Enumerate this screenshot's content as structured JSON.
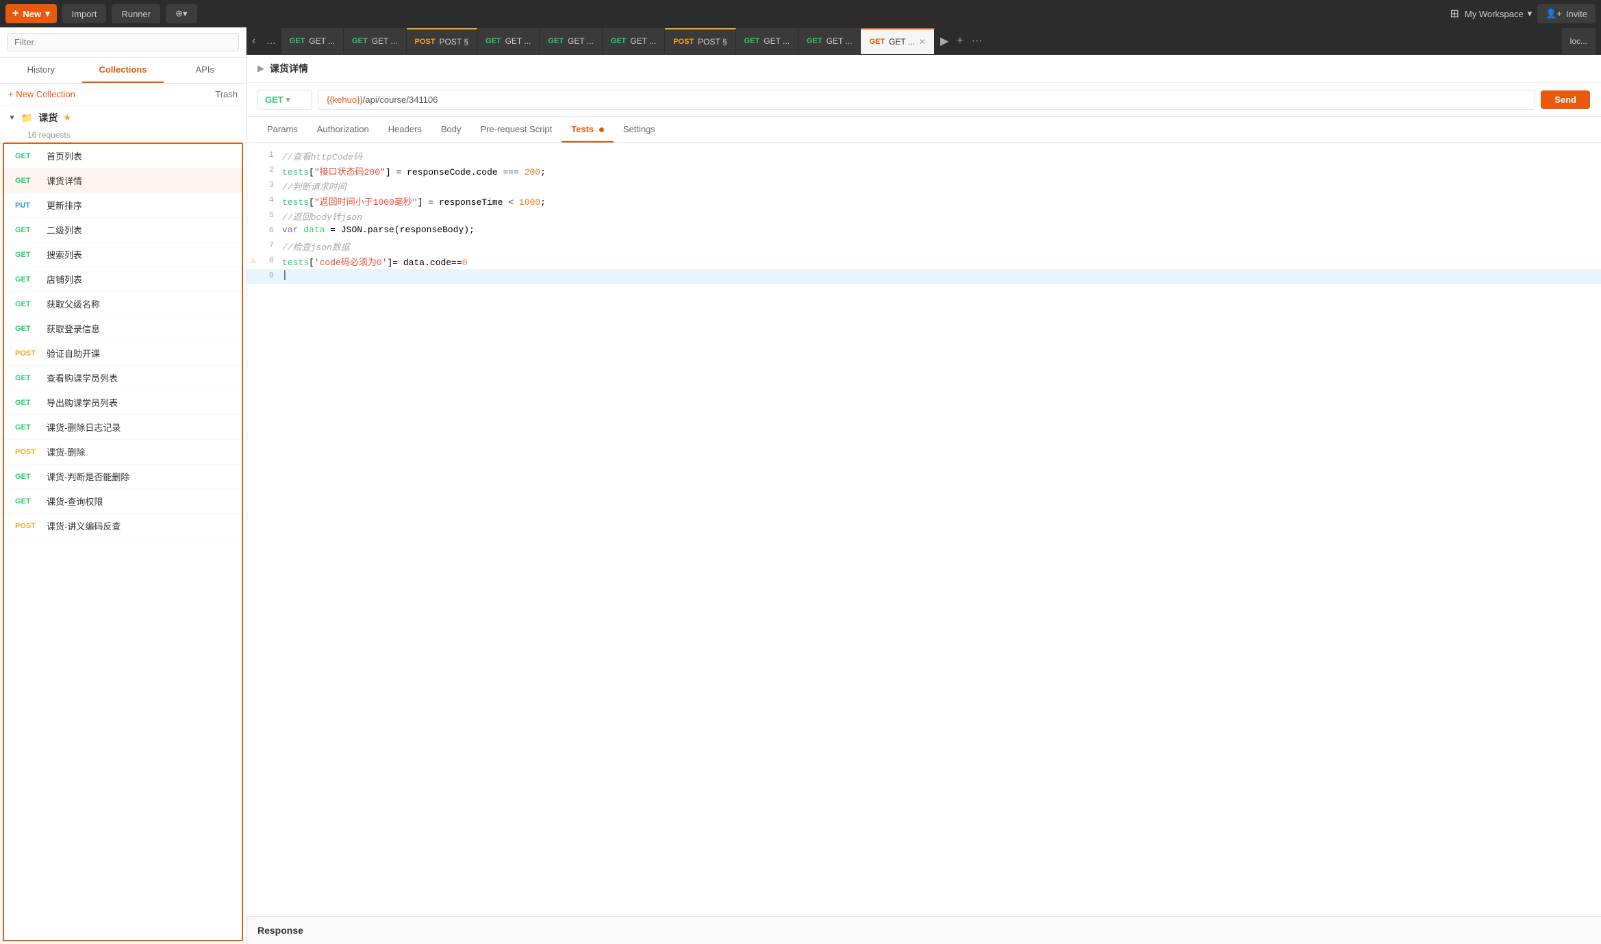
{
  "topbar": {
    "new_label": "New",
    "import_label": "Import",
    "runner_label": "Runner",
    "workspace_label": "My Workspace",
    "invite_label": "Invite"
  },
  "sidebar": {
    "filter_placeholder": "Filter",
    "tabs": [
      "History",
      "Collections",
      "APIs"
    ],
    "active_tab": "Collections",
    "new_collection_label": "+ New Collection",
    "trash_label": "Trash",
    "collection_name": "课货",
    "collection_count": "16 requests",
    "requests": [
      {
        "method": "GET",
        "name": "首页列表",
        "active": false
      },
      {
        "method": "GET",
        "name": "课货详情",
        "active": true
      },
      {
        "method": "PUT",
        "name": "更新排序",
        "active": false
      },
      {
        "method": "GET",
        "name": "二级列表",
        "active": false
      },
      {
        "method": "GET",
        "name": "搜索列表",
        "active": false
      },
      {
        "method": "GET",
        "name": "店铺列表",
        "active": false
      },
      {
        "method": "GET",
        "name": "获取父级名称",
        "active": false
      },
      {
        "method": "GET",
        "name": "获取登录信息",
        "active": false
      },
      {
        "method": "POST",
        "name": "验证自助开课",
        "active": false
      },
      {
        "method": "GET",
        "name": "查看购课学员列表",
        "active": false
      },
      {
        "method": "GET",
        "name": "导出购课学员列表",
        "active": false
      },
      {
        "method": "GET",
        "name": "课货-删除日志记录",
        "active": false
      },
      {
        "method": "POST",
        "name": "课货-删除",
        "active": false
      },
      {
        "method": "GET",
        "name": "课货-判断是否能删除",
        "active": false
      },
      {
        "method": "GET",
        "name": "课货-查询权限",
        "active": false
      },
      {
        "method": "POST",
        "name": "课货-讲义编码反查",
        "active": false
      }
    ]
  },
  "tabs_bar": {
    "tabs": [
      {
        "method": "GET",
        "label": "GET ...",
        "active": false,
        "closable": false
      },
      {
        "method": "GET",
        "label": "GET ...",
        "active": false,
        "closable": false
      },
      {
        "method": "POST",
        "label": "POST §",
        "active": false,
        "closable": false
      },
      {
        "method": "GET",
        "label": "GET ...",
        "active": false,
        "closable": false
      },
      {
        "method": "GET",
        "label": "GET ...",
        "active": false,
        "closable": false
      },
      {
        "method": "GET",
        "label": "GET ...",
        "active": false,
        "closable": false
      },
      {
        "method": "POST",
        "label": "POST §",
        "active": false,
        "closable": false
      },
      {
        "method": "GET",
        "label": "GET ...",
        "active": false,
        "closable": false
      },
      {
        "method": "GET",
        "label": "GET ...",
        "active": false,
        "closable": false
      },
      {
        "method": "GET",
        "label": "GET ...",
        "active": true,
        "closable": true
      }
    ]
  },
  "request": {
    "breadcrumb": "课货详情",
    "method": "GET",
    "url_prefix": "{{kehuo}}",
    "url_suffix": "/api/course/341106",
    "tabs": [
      "Params",
      "Authorization",
      "Headers",
      "Body",
      "Pre-request Script",
      "Tests",
      "Settings"
    ],
    "active_tab": "Tests",
    "tests_dot": true
  },
  "code_editor": {
    "lines": [
      {
        "num": 1,
        "content": "//查看httpCode码",
        "type": "comment",
        "warn": false,
        "active": false
      },
      {
        "num": 2,
        "content": "tests[\"接口状态码200\"] = responseCode.code === 200;",
        "type": "code",
        "warn": false,
        "active": false
      },
      {
        "num": 3,
        "content": "//判断请求时间",
        "type": "comment",
        "warn": false,
        "active": false
      },
      {
        "num": 4,
        "content": "tests[\"返回时间小于1000毫秒\"] = responseTime < 1000;",
        "type": "code",
        "warn": false,
        "active": false
      },
      {
        "num": 5,
        "content": "//返回body转json",
        "type": "comment",
        "warn": false,
        "active": false
      },
      {
        "num": 6,
        "content": "var data = JSON.parse(responseBody);",
        "type": "code",
        "warn": false,
        "active": false
      },
      {
        "num": 7,
        "content": "//检查json数据",
        "type": "comment",
        "warn": false,
        "active": false
      },
      {
        "num": 8,
        "content": "tests['code码必须为0']= data.code==0",
        "type": "code",
        "warn": true,
        "active": false
      },
      {
        "num": 9,
        "content": "",
        "type": "code",
        "warn": false,
        "active": true
      }
    ]
  },
  "response": {
    "label": "Response"
  }
}
